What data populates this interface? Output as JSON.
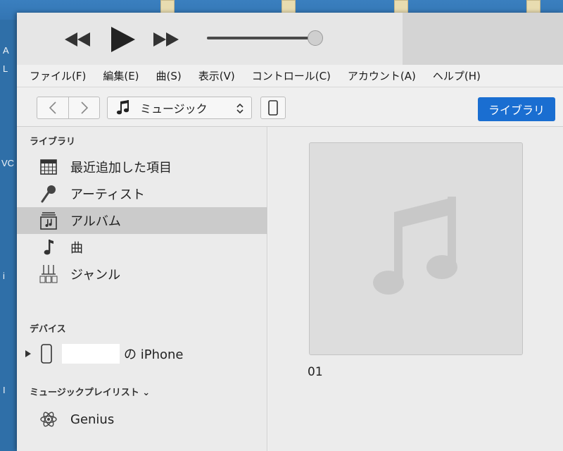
{
  "desktop": {
    "left_letters": [
      "A",
      "L",
      "VC",
      "i",
      "I"
    ]
  },
  "menu": {
    "items": [
      "ファイル(F)",
      "編集(E)",
      "曲(S)",
      "表示(V)",
      "コントロール(C)",
      "アカウント(A)",
      "ヘルプ(H)"
    ]
  },
  "toolbar": {
    "media_kind": "ミュージック",
    "library_button": "ライブラリ"
  },
  "sidebar": {
    "library_title": "ライブラリ",
    "library_items": [
      {
        "label": "最近追加した項目",
        "icon": "grid-calendar-icon"
      },
      {
        "label": "アーティスト",
        "icon": "microphone-icon"
      },
      {
        "label": "アルバム",
        "icon": "album-icon",
        "selected": true
      },
      {
        "label": "曲",
        "icon": "music-note-icon"
      },
      {
        "label": "ジャンル",
        "icon": "genre-icon"
      }
    ],
    "devices_title": "デバイス",
    "device_suffix": "の iPhone",
    "playlists_title": "ミュージックプレイリスト ⌄",
    "playlist_items": [
      {
        "label": "Genius",
        "icon": "atom-icon"
      }
    ]
  },
  "content": {
    "album_title": "01"
  },
  "colors": {
    "accent": "#1a6ed1",
    "selected_row": "#cbcbcb"
  }
}
